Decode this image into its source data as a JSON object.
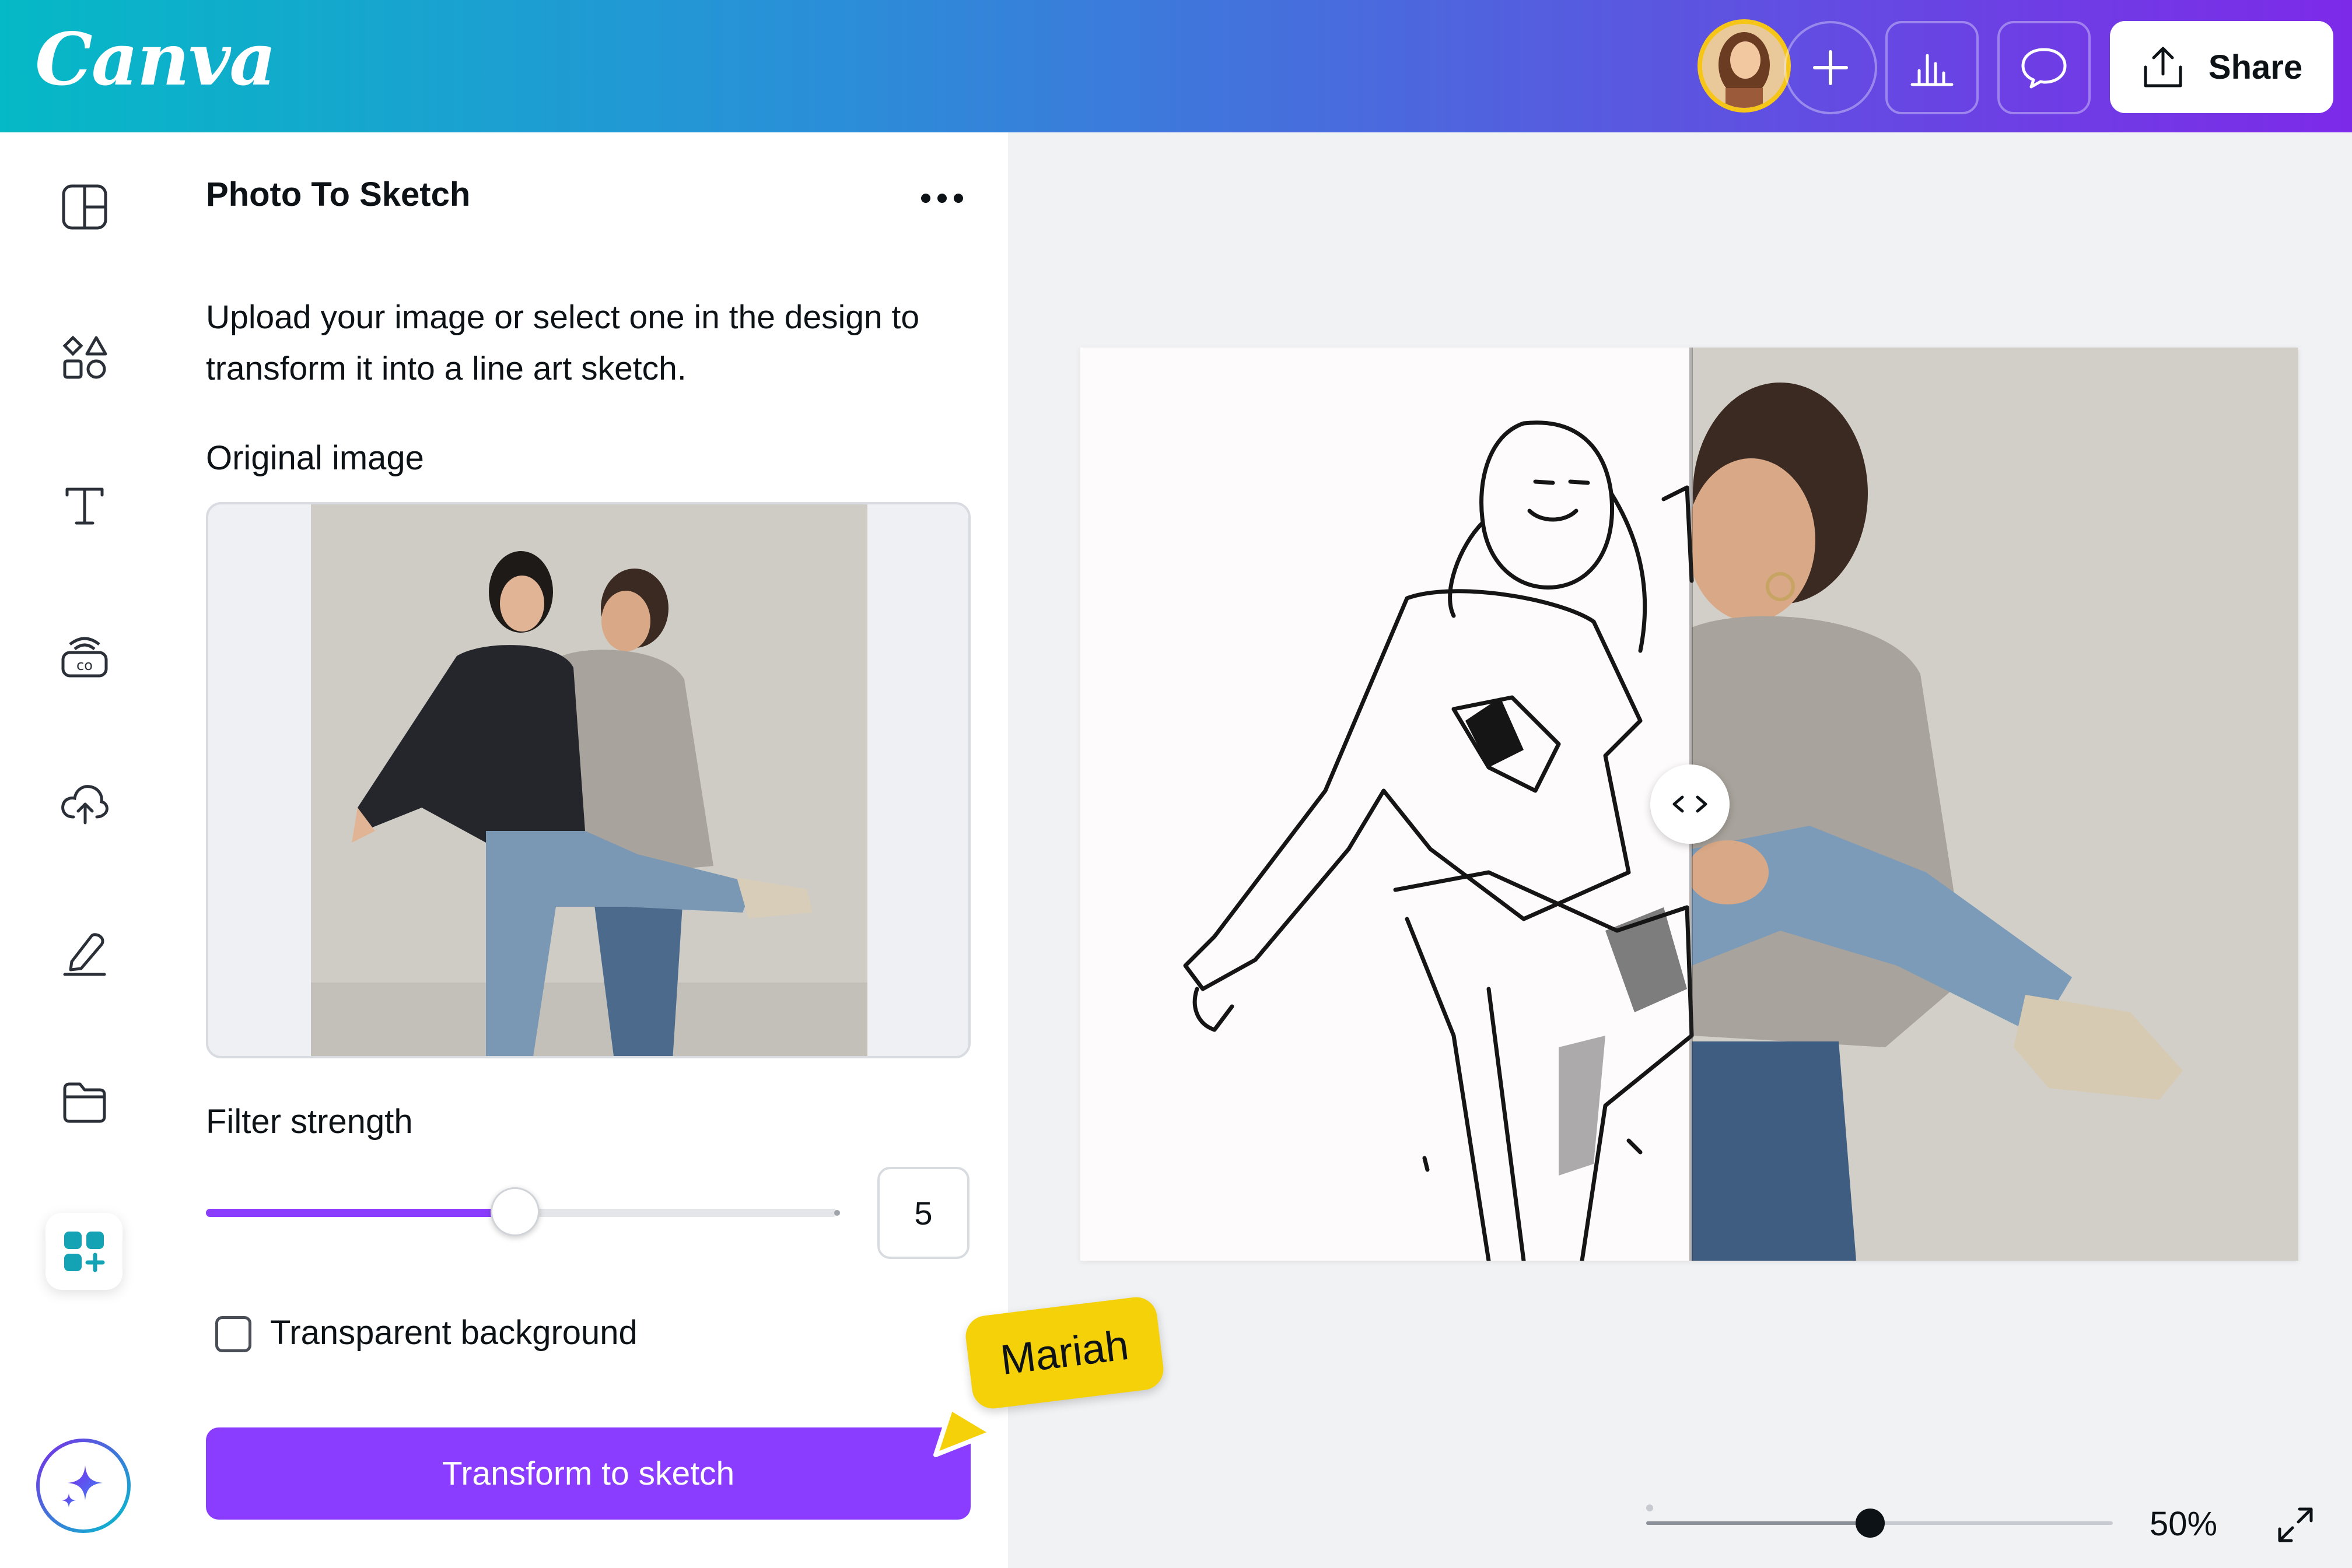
{
  "header": {
    "logo": "Canva",
    "share_label": "Share",
    "gradient": [
      "#05b9c6",
      "#7d2ae8"
    ]
  },
  "rail": {
    "icons": [
      "layout-icon",
      "elements-icon",
      "text-icon",
      "brand-icon",
      "uploads-icon",
      "draw-icon",
      "projects-icon",
      "apps-icon",
      "magic-icon"
    ]
  },
  "panel": {
    "title": "Photo To Sketch",
    "description": "Upload your image or select one in the design to transform it into a line art sketch.",
    "original_label": "Original image",
    "filter_label": "Filter strength",
    "filter_value": "5",
    "filter_fraction": 0.49,
    "checkbox_label": "Transparent background",
    "checkbox_checked": false,
    "button_label": "Transform to sketch",
    "accent": "#8b3dff"
  },
  "canvas": {
    "zoom_label": "50%",
    "zoom_fraction": 0.48
  },
  "collaborator": {
    "name": "Mariah",
    "color": "#f5d10a"
  }
}
